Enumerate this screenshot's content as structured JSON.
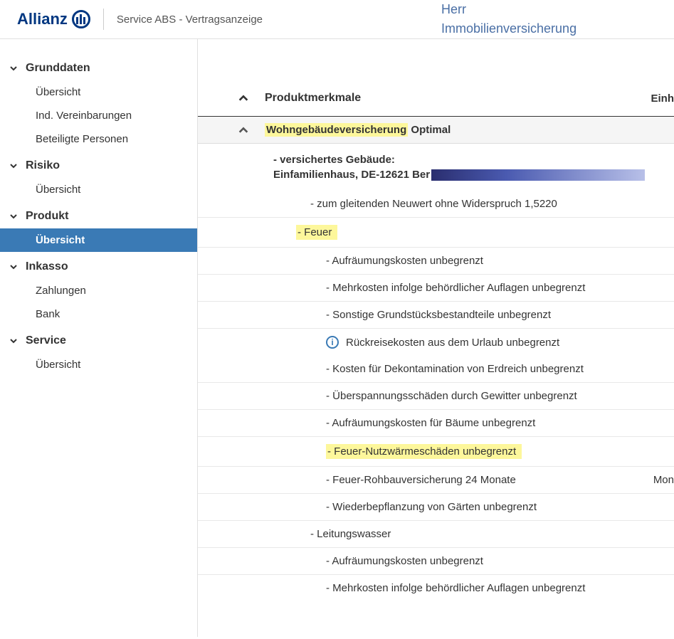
{
  "header": {
    "brand": "Allianz",
    "title": "Service ABS - Vertragsanzeige",
    "customer_salutation": "Herr",
    "customer_product": "Immobilienversicherung"
  },
  "sidebar": {
    "sections": [
      {
        "label": "Grunddaten",
        "items": [
          "Übersicht",
          "Ind. Vereinbarungen",
          "Beteiligte Personen"
        ]
      },
      {
        "label": "Risiko",
        "items": [
          "Übersicht"
        ]
      },
      {
        "label": "Produkt",
        "items": [
          "Übersicht"
        ],
        "active_index": 0
      },
      {
        "label": "Inkasso",
        "items": [
          "Zahlungen",
          "Bank"
        ]
      },
      {
        "label": "Service",
        "items": [
          "Übersicht"
        ]
      }
    ]
  },
  "content": {
    "section_title": "Produktmerkmale",
    "section_right": "Einh",
    "product_line1": "Wohngebäudeversicherung",
    "product_line2": " Optimal",
    "building": {
      "label": "- versichertes Gebäude:",
      "address_prefix": "Einfamilienhaus, DE-12621 Ber"
    },
    "items": [
      {
        "indent": 1,
        "text": "- zum gleitenden Neuwert ohne Widerspruch 1,5220"
      },
      {
        "indent": 2,
        "text": "- Feuer",
        "highlight": true
      },
      {
        "indent": 3,
        "text": "- Aufräumungskosten unbegrenzt"
      },
      {
        "indent": 3,
        "text": "- Mehrkosten infolge behördlicher Auflagen unbegrenzt"
      },
      {
        "indent": 3,
        "text": "- Sonstige Grundstücksbestandteile unbegrenzt"
      },
      {
        "indent": 3,
        "text": "Rückreisekosten aus dem Urlaub unbegrenzt",
        "info": true,
        "no_border": true
      },
      {
        "indent": 3,
        "text": "- Kosten für Dekontamination von Erdreich unbegrenzt"
      },
      {
        "indent": 3,
        "text": "- Überspannungsschäden durch Gewitter unbegrenzt"
      },
      {
        "indent": 3,
        "text": "- Aufräumungskosten für Bäume unbegrenzt"
      },
      {
        "indent": 3,
        "text": "- Feuer-Nutzwärmeschäden unbegrenzt",
        "highlight": true
      },
      {
        "indent": 3,
        "text": "- Feuer-Rohbauversicherung 24 Monate",
        "right": "Mon"
      },
      {
        "indent": 3,
        "text": "- Wiederbepflanzung von Gärten unbegrenzt"
      },
      {
        "indent": 4,
        "text": "- Leitungswasser"
      },
      {
        "indent": 3,
        "text": "- Aufräumungskosten unbegrenzt"
      },
      {
        "indent": 3,
        "text": "- Mehrkosten infolge behördlicher Auflagen unbegrenzt",
        "no_border": true
      }
    ]
  }
}
